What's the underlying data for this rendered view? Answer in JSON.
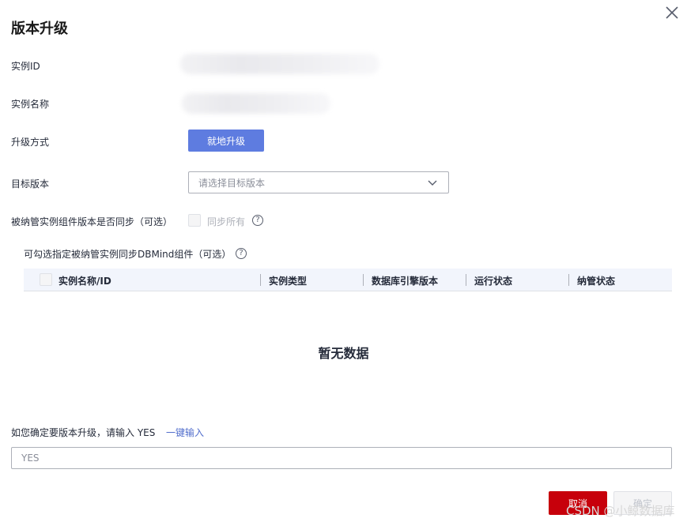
{
  "dialog": {
    "title": "版本升级",
    "close_icon": "close-icon"
  },
  "form": {
    "instance_id_label": "实例ID",
    "instance_name_label": "实例名称",
    "upgrade_mode_label": "升级方式",
    "upgrade_mode_button": "就地升级",
    "target_version_label": "目标版本",
    "target_version_placeholder": "请选择目标版本",
    "sync_label": "被纳管实例组件版本是否同步（可选）",
    "sync_checkbox_label": "同步所有",
    "help_glyph": "?"
  },
  "component_table": {
    "subtitle": "可勾选指定被纳管实例同步DBMind组件（可选）",
    "columns": [
      "实例名称/ID",
      "实例类型",
      "数据库引擎版本",
      "运行状态",
      "纳管状态"
    ],
    "empty_text": "暂无数据"
  },
  "confirm": {
    "prompt": "如您确定要版本升级，请输入 YES",
    "one_click_link": "一键输入",
    "input_placeholder": "YES"
  },
  "footer": {
    "cancel_label": "取消",
    "ok_label": "确定"
  },
  "watermark": "CSDN @小鲸数据库",
  "colors": {
    "primary_button": "#5e7ce0",
    "cancel_button": "#c7000b",
    "link": "#526ecc",
    "table_header_bg": "#f2f5fc"
  }
}
